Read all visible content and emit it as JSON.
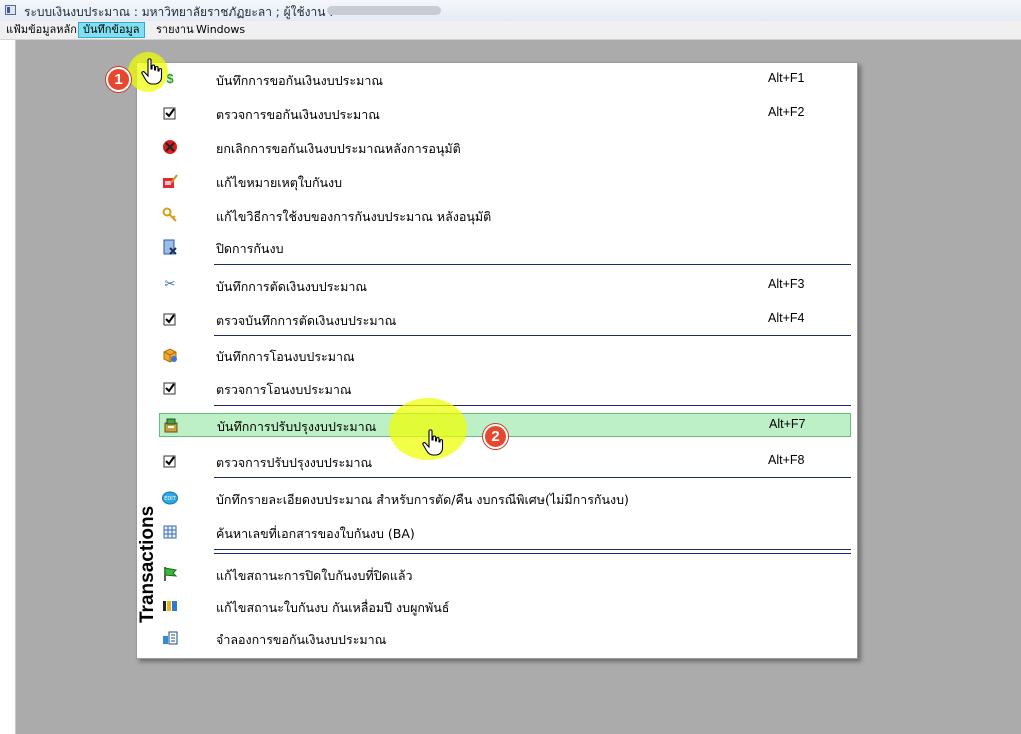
{
  "window": {
    "title": "ระบบเงินงบประมาณ : มหาวิทยาลัยราชภัฏยะลา ; ผู้ใช้งาน :",
    "user_name_redacted": true
  },
  "menubar": {
    "items": [
      "แฟ้มข้อมูลหลัก",
      "บันทึกข้อมูล",
      "รายงาน",
      "Windows"
    ],
    "active_index": 1
  },
  "dropdown": {
    "side_label": "Transactions",
    "items": [
      {
        "icon": "dollar-icon",
        "label": "บันทึกการขอกันเงินงบประมาณ",
        "shortcut": "Alt+F1"
      },
      {
        "icon": "check-box-icon",
        "label": "ตรวจการขอกันเงินงบประมาณ",
        "shortcut": "Alt+F2"
      },
      {
        "icon": "cancel-icon",
        "label": "ยกเลิกการขอกันเงินงบประมาณหลังการอนุมัติ",
        "shortcut": ""
      },
      {
        "icon": "edit-note-icon",
        "label": "แก้ไขหมายเหตุใบกันงบ",
        "shortcut": ""
      },
      {
        "icon": "key-icon",
        "label": "แก้ไขวิธีการใช้งบของการกันงบประมาณ หลังอนุมัติ",
        "shortcut": ""
      },
      {
        "icon": "close-document-icon",
        "label": "ปิดการกันงบ",
        "shortcut": ""
      },
      {
        "icon": "scissors-icon",
        "label": "บันทึกการตัดเงินงบประมาณ",
        "shortcut": "Alt+F3"
      },
      {
        "icon": "check-box-icon",
        "label": "ตรวจบันทึกการตัดเงินงบประมาณ",
        "shortcut": "Alt+F4"
      },
      {
        "icon": "box-transfer-icon",
        "label": "บันทึกการโอนงบประมาณ",
        "shortcut": ""
      },
      {
        "icon": "check-box-icon",
        "label": "ตรวจการโอนงบประมาณ",
        "shortcut": ""
      },
      {
        "icon": "adjust-budget-icon",
        "label": "บันทึกการปรับปรุงงบประมาณ",
        "shortcut": "Alt+F7"
      },
      {
        "icon": "check-box-icon",
        "label": "ตรวจการปรับปรุงงบประมาณ",
        "shortcut": "Alt+F8"
      },
      {
        "icon": "edit-badge-icon",
        "label": "บักทึกรายละเอียดงบประมาณ  สำหรับการตัด/คืน  งบกรณีพิเศษ(ไม่มีการกันงบ)",
        "shortcut": ""
      },
      {
        "icon": "grid-search-icon",
        "label": "ค้นหาเลขที่เอกสารของใบกันงบ  (BA)",
        "shortcut": ""
      },
      {
        "icon": "flag-icon",
        "label": "แก้ไขสถานะการปิดใบกันงบที่ปิดแล้ว",
        "shortcut": ""
      },
      {
        "icon": "status-icon",
        "label": "แก้ไขสถานะใบกันงบ กันเหลื่อมปี งบผูกพันธ์",
        "shortcut": ""
      },
      {
        "icon": "simulate-icon",
        "label": "จำลองการขอกันเงินงบประมาณ",
        "shortcut": ""
      }
    ],
    "highlighted_index": 10
  },
  "annotations": {
    "step1": "1",
    "step2": "2"
  },
  "colors": {
    "workspace": "#ababab",
    "menubar_active": "#7fe0f2",
    "highlight_row": "#bdf0c7",
    "badge": "#e8472f",
    "glow": "#eeff00",
    "separator": "#1d2a6b"
  }
}
